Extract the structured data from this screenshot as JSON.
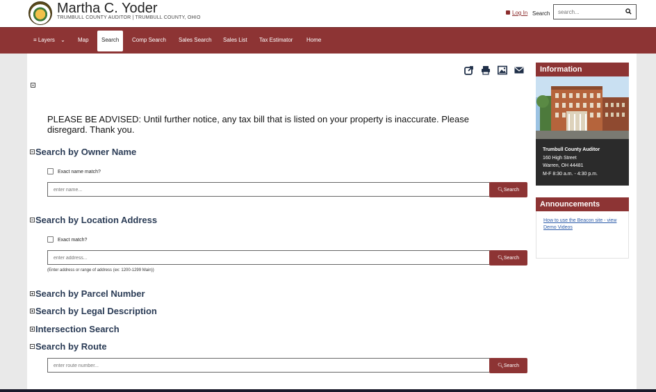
{
  "header": {
    "name": "Martha C. Yoder",
    "subtitle": "TRUMBULL COUNTY AUDITOR | TRUMBULL COUNTY, OHIO",
    "login_label": "Log In",
    "search_label": "Search",
    "search_placeholder": "search..."
  },
  "nav": {
    "items": [
      "Layers",
      "Map",
      "Search",
      "Comp Search",
      "Sales Search",
      "Sales List",
      "Tax Estimator",
      "Home"
    ]
  },
  "main": {
    "advisory": "PLEASE BE ADVISED: Until further notice, any tax bill that is listed on your property is inaccurate. Please disregard. Thank you.",
    "owner": {
      "title": "Search by Owner Name",
      "checkbox_label": "Exact name match?",
      "placeholder": "enter name...",
      "button": "Search"
    },
    "location": {
      "title": "Search by Location Address",
      "checkbox_label": "Exact match?",
      "placeholder": "enter address...",
      "button": "Search",
      "hint": "(Enter address or range of address (ex: 1200-1299 Main))"
    },
    "parcel_title": "Search by Parcel Number",
    "legal_title": "Search by Legal Description",
    "intersection_title": "Intersection Search",
    "route": {
      "title": "Search by Route",
      "placeholder": "enter route number...",
      "button": "Search"
    }
  },
  "sidebar": {
    "info_title": "Information",
    "info_lines": [
      "Trumbull County Auditor",
      "160 High Street",
      "Warren, OH 44481",
      "M-F 8:30 a.m. - 4:30 p.m."
    ],
    "announcements_title": "Announcements",
    "announcement_link": "How to use the Beacon site - view Demo Videos"
  },
  "colors": {
    "brand": "#8d3434",
    "heading": "#2a3b55",
    "link": "#2a5aa8"
  }
}
